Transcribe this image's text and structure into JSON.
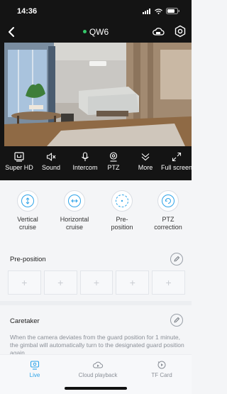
{
  "status_bar": {
    "time": "14:36"
  },
  "header": {
    "device_name": "QW6",
    "online_color": "#35c96a"
  },
  "controls": [
    {
      "label": "Super HD",
      "icon": "hd-icon"
    },
    {
      "label": "Sound",
      "icon": "mute-icon"
    },
    {
      "label": "Intercom",
      "icon": "microphone-icon"
    },
    {
      "label": "PTZ",
      "icon": "ptz-icon"
    },
    {
      "label": "More",
      "icon": "chevron-double-down-icon"
    },
    {
      "label": "Full screen",
      "icon": "fullscreen-icon"
    }
  ],
  "ptz_actions": [
    {
      "label_line1": "Vertical",
      "label_line2": "cruise",
      "icon": "vertical-cruise-icon"
    },
    {
      "label_line1": "Horizontal",
      "label_line2": "cruise",
      "icon": "horizontal-cruise-icon"
    },
    {
      "label_line1": "Pre-",
      "label_line2": "position",
      "icon": "preposition-icon"
    },
    {
      "label_line1": "PTZ",
      "label_line2": "correction",
      "icon": "ptz-correction-icon"
    }
  ],
  "preposition": {
    "title": "Pre-position",
    "slot_glyph": "+"
  },
  "caretaker": {
    "title": "Caretaker",
    "description": "When the camera deviates from the guard position for 1 minute, the gimbal will automatically turn to the designated guard position again"
  },
  "tabs": [
    {
      "label": "Live",
      "icon": "live-icon",
      "active": true
    },
    {
      "label": "Cloud playback",
      "icon": "cloud-playback-icon",
      "active": false
    },
    {
      "label": "TF Card",
      "icon": "tf-card-icon",
      "active": false
    }
  ],
  "accent_color": "#2da3e8"
}
